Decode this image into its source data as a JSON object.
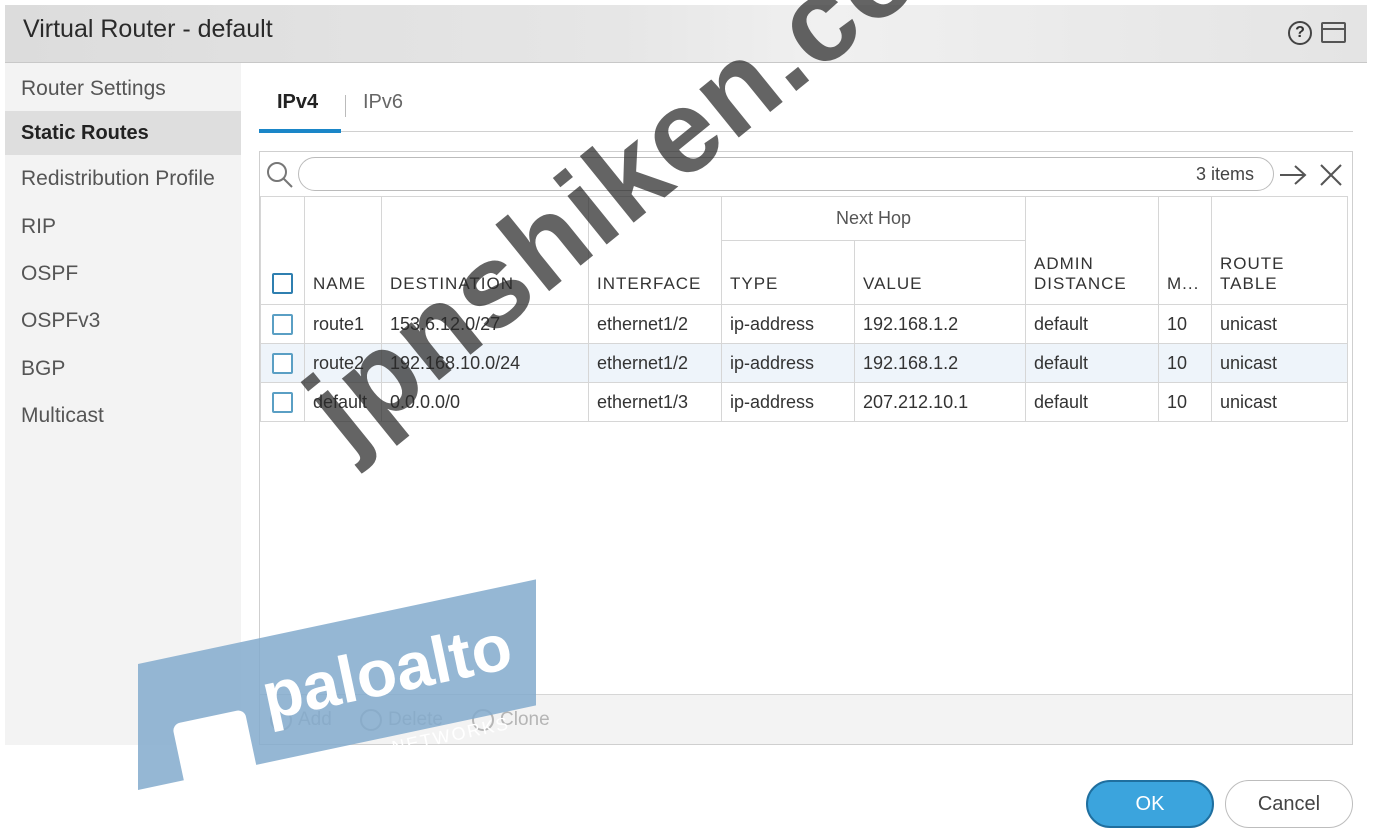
{
  "window": {
    "title": "Virtual Router - default"
  },
  "sidebar": {
    "items": [
      {
        "label": "Router Settings"
      },
      {
        "label": "Static Routes"
      },
      {
        "label": "Redistribution Profile"
      },
      {
        "label": "RIP"
      },
      {
        "label": "OSPF"
      },
      {
        "label": "OSPFv3"
      },
      {
        "label": "BGP"
      },
      {
        "label": "Multicast"
      }
    ],
    "active": "Static Routes"
  },
  "tabs": [
    {
      "label": "IPv4"
    },
    {
      "label": "IPv6"
    }
  ],
  "search": {
    "value": "",
    "count": "3 items"
  },
  "table": {
    "group_header": "Next Hop",
    "columns": [
      "NAME",
      "DESTINATION",
      "INTERFACE",
      "TYPE",
      "VALUE",
      "ADMIN DISTANCE",
      "M...",
      "ROUTE TABLE"
    ],
    "admin_line1": "ADMIN",
    "admin_line2": "DISTANCE",
    "route_line1": "ROUTE",
    "route_line2": "TABLE",
    "rows": [
      {
        "name": "route1",
        "destination": "153.6.12.0/27",
        "interface": "ethernet1/2",
        "type": "ip-address",
        "value": "192.168.1.2",
        "admin": "default",
        "metric": "10",
        "route_table": "unicast"
      },
      {
        "name": "route2",
        "destination": "192.168.10.0/24",
        "interface": "ethernet1/2",
        "type": "ip-address",
        "value": "192.168.1.2",
        "admin": "default",
        "metric": "10",
        "route_table": "unicast"
      },
      {
        "name": "default",
        "destination": "0.0.0.0/0",
        "interface": "ethernet1/3",
        "type": "ip-address",
        "value": "207.212.10.1",
        "admin": "default",
        "metric": "10",
        "route_table": "unicast"
      }
    ]
  },
  "footer": {
    "add": "Add",
    "delete": "Delete",
    "clone": "Clone"
  },
  "buttons": {
    "ok": "OK",
    "cancel": "Cancel"
  },
  "watermark": {
    "text": "jpnshiken.com",
    "logo": "paloalto",
    "logo_sub": "NETWORKS"
  },
  "colors": {
    "accent": "#1a86c8",
    "ok_button": "#3ba4dd",
    "selected_row": "#eef4fa"
  }
}
